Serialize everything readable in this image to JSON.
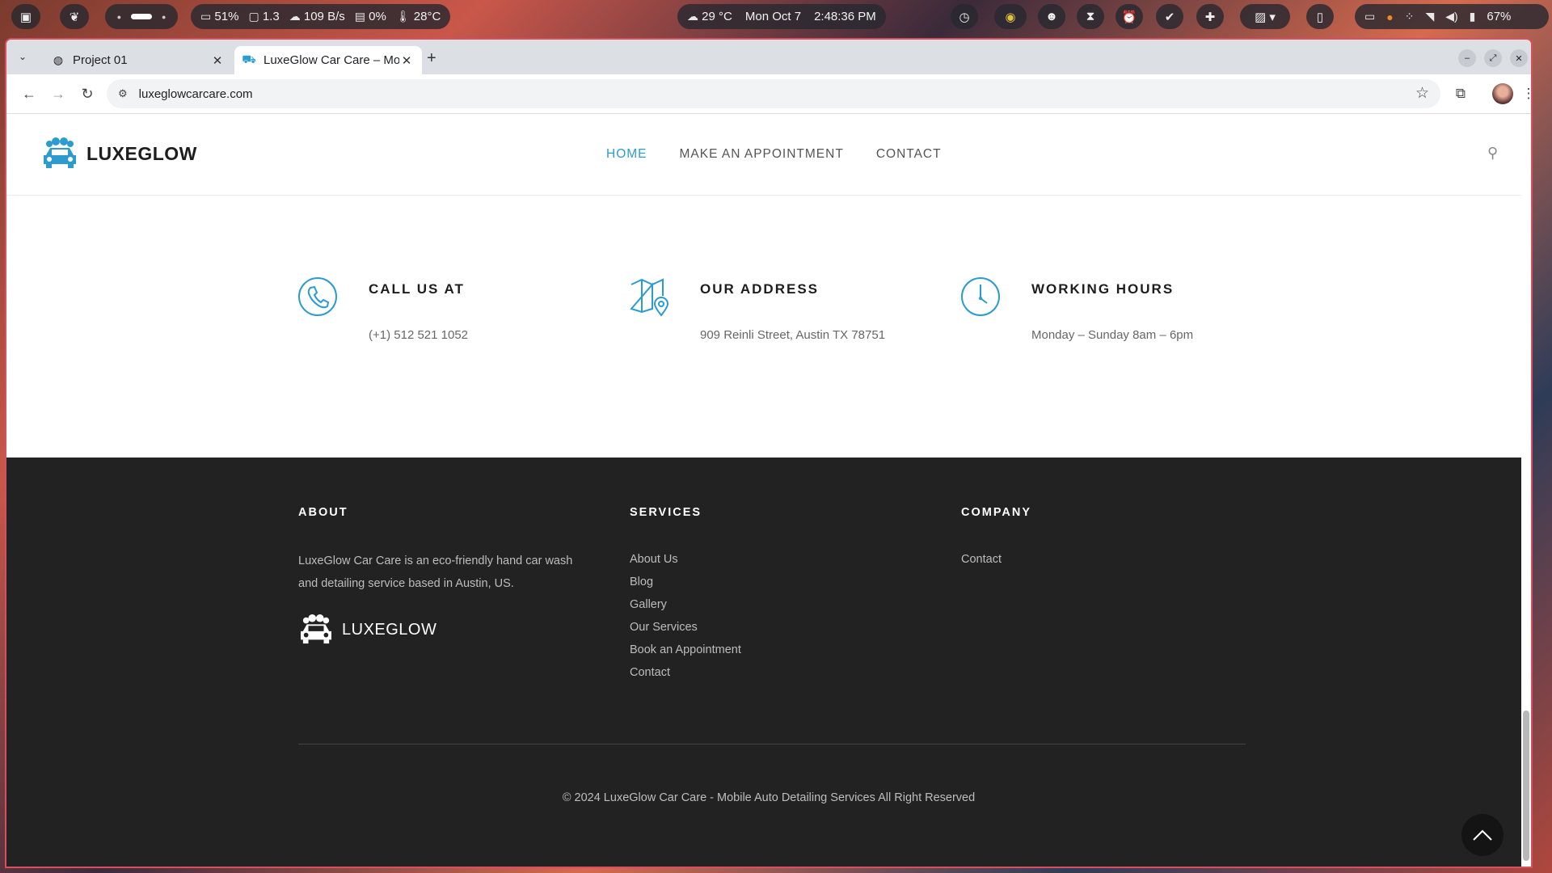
{
  "system_bar": {
    "battery_saver": "51%",
    "cpu": "1.3",
    "network": "109 B/s",
    "mem": "0%",
    "temp": "28°C",
    "weather": "29 °C",
    "date": "Mon Oct 7",
    "time": "2:48:36 PM",
    "battery": "67%"
  },
  "browser": {
    "tabs": [
      {
        "label": "Project 01",
        "favicon": "globe-icon"
      },
      {
        "label": "LuxeGlow Car Care – Mo",
        "favicon": "car-icon"
      }
    ],
    "url": "luxeglowcarcare.com"
  },
  "site": {
    "brand": "LUXEGLOW",
    "nav": [
      {
        "label": "HOME",
        "active": true
      },
      {
        "label": "MAKE AN APPOINTMENT",
        "active": false
      },
      {
        "label": "CONTACT",
        "active": false
      }
    ],
    "accent_color": "#2b9bd0",
    "info": [
      {
        "title": "CALL US AT",
        "text": "(+1) 512 521 1052",
        "icon": "phone-icon"
      },
      {
        "title": "OUR ADDRESS",
        "text": "909 Reinli Street, Austin TX 78751",
        "icon": "map-pin-icon"
      },
      {
        "title": "WORKING HOURS",
        "text": "Monday – Sunday 8am – 6pm",
        "icon": "clock-icon"
      }
    ],
    "footer": {
      "about_title": "ABOUT",
      "about_text": "LuxeGlow Car Care is an eco-friendly hand car wash and detailing service based in Austin, US.",
      "services_title": "SERVICES",
      "services": [
        "About Us",
        "Blog",
        "Gallery",
        "Our Services",
        "Book an Appointment",
        "Contact"
      ],
      "company_title": "COMPANY",
      "company": [
        "Contact"
      ],
      "copyright": "© 2024 LuxeGlow Car Care - Mobile Auto Detailing Services All Right Reserved",
      "bg_color": "#222222"
    }
  }
}
